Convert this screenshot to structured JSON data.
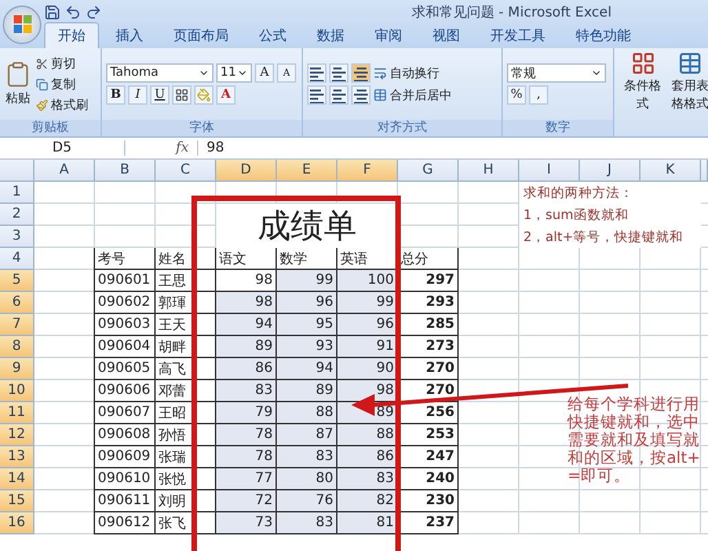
{
  "window": {
    "title": "求和常见问题 - Microsoft Excel"
  },
  "tabs": [
    {
      "label": "开始",
      "selected": true
    },
    {
      "label": "插入",
      "selected": false
    },
    {
      "label": "页面布局",
      "selected": false
    },
    {
      "label": "公式",
      "selected": false
    },
    {
      "label": "数据",
      "selected": false
    },
    {
      "label": "审阅",
      "selected": false
    },
    {
      "label": "视图",
      "selected": false
    },
    {
      "label": "开发工具",
      "selected": false
    },
    {
      "label": "特色功能",
      "selected": false
    }
  ],
  "ribbon": {
    "clipboard": {
      "paste": "粘贴",
      "cut": "剪切",
      "copy": "复制",
      "format_painter": "格式刷",
      "label": "剪贴板"
    },
    "font": {
      "name": "Tahoma",
      "size": "11",
      "grow": "A",
      "shrink": "A",
      "bold": "B",
      "italic": "I",
      "underline": "U",
      "font_color_button": "A",
      "label": "字体"
    },
    "alignment": {
      "wrap": "自动换行",
      "merge": "合并后居中",
      "label": "对齐方式"
    },
    "number": {
      "format": "常规",
      "percent": "%",
      "comma": ",",
      "label": "数字"
    },
    "styles": {
      "conditional": "条件格式",
      "table_format": "套用表格格式"
    }
  },
  "formula_bar": {
    "cell": "D5",
    "function_label": "fx",
    "value": "98"
  },
  "sheet": {
    "columns": [
      {
        "label": "A",
        "selected": false
      },
      {
        "label": "B",
        "selected": false
      },
      {
        "label": "C",
        "selected": false
      },
      {
        "label": "D",
        "selected": true
      },
      {
        "label": "E",
        "selected": true
      },
      {
        "label": "F",
        "selected": true
      },
      {
        "label": "G",
        "selected": false
      },
      {
        "label": "H",
        "selected": false
      },
      {
        "label": "I",
        "selected": false
      },
      {
        "label": "J",
        "selected": false
      },
      {
        "label": "K",
        "selected": false
      }
    ],
    "rows": [
      {
        "label": "1",
        "selected": false
      },
      {
        "label": "2",
        "selected": false
      },
      {
        "label": "3",
        "selected": false
      },
      {
        "label": "4",
        "selected": false
      },
      {
        "label": "5",
        "selected": true
      },
      {
        "label": "6",
        "selected": true
      },
      {
        "label": "7",
        "selected": true
      },
      {
        "label": "8",
        "selected": true
      },
      {
        "label": "9",
        "selected": true
      },
      {
        "label": "10",
        "selected": true
      },
      {
        "label": "11",
        "selected": true
      },
      {
        "label": "12",
        "selected": true
      },
      {
        "label": "13",
        "selected": true
      },
      {
        "label": "14",
        "selected": true
      },
      {
        "label": "15",
        "selected": true
      },
      {
        "label": "16",
        "selected": true
      }
    ]
  },
  "table": {
    "title": "成绩单",
    "headers": [
      "考号",
      "姓名",
      "语文",
      "数学",
      "英语",
      "总分"
    ],
    "records": [
      [
        "090601",
        "王思",
        "98",
        "99",
        "100",
        "297"
      ],
      [
        "090602",
        "郭琿",
        "98",
        "96",
        "99",
        "293"
      ],
      [
        "090603",
        "王天",
        "94",
        "95",
        "96",
        "285"
      ],
      [
        "090604",
        "胡畔",
        "89",
        "93",
        "91",
        "273"
      ],
      [
        "090605",
        "高飞",
        "86",
        "94",
        "90",
        "270"
      ],
      [
        "090606",
        "邓蕾",
        "83",
        "89",
        "98",
        "270"
      ],
      [
        "090607",
        "王昭",
        "79",
        "88",
        "89",
        "256"
      ],
      [
        "090608",
        "孙悟",
        "78",
        "87",
        "88",
        "253"
      ],
      [
        "090609",
        "张瑞",
        "78",
        "83",
        "86",
        "247"
      ],
      [
        "090610",
        "张悦",
        "77",
        "80",
        "83",
        "240"
      ],
      [
        "090611",
        "刘明",
        "72",
        "76",
        "82",
        "230"
      ],
      [
        "090612",
        "张飞",
        "73",
        "83",
        "81",
        "237"
      ]
    ]
  },
  "notes": [
    "求和的两种方法：",
    "1，sum函数就和",
    "2，alt+等号，快捷键就和"
  ],
  "callout": {
    "text": "给每个学科进行用快捷键就和，选中需要就和及填写就和的区域，按alt+=即可。"
  }
}
